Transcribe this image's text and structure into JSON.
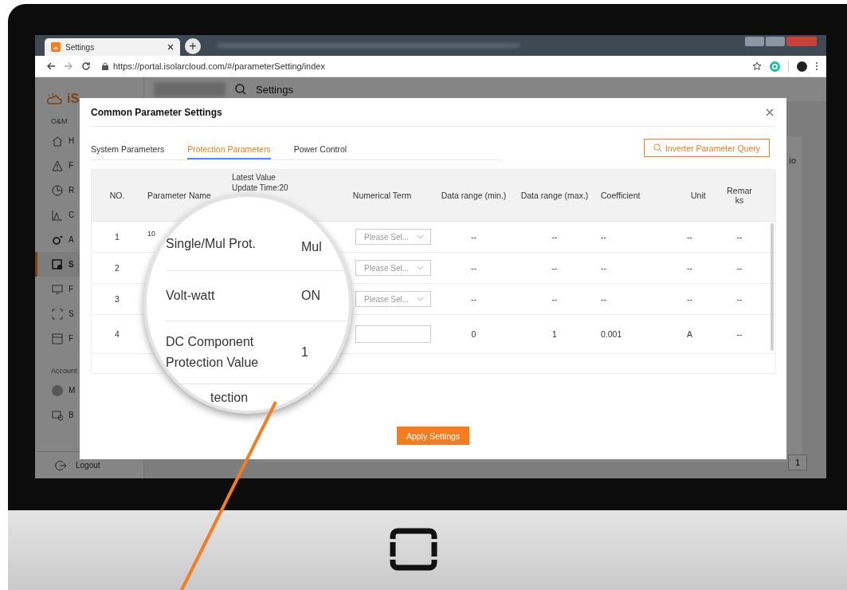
{
  "browser": {
    "tab_title": "Settings",
    "new_tab": "+",
    "url": "https://portal.isolarcloud.com/#/parameterSetting/index"
  },
  "app": {
    "logo": "iS",
    "header_title": "Settings",
    "section": "O&M",
    "sidebar": [
      {
        "label": "H",
        "kind": "home",
        "selected": false
      },
      {
        "label": "F",
        "kind": "alert",
        "selected": false
      },
      {
        "label": "R",
        "kind": "clock",
        "selected": false
      },
      {
        "label": "C",
        "kind": "chart",
        "selected": false
      },
      {
        "label": "A",
        "kind": "gear",
        "selected": false
      },
      {
        "label": "S",
        "kind": "settings",
        "selected": true
      },
      {
        "label": "F",
        "kind": "monitor",
        "selected": false
      },
      {
        "label": "S",
        "kind": "scan",
        "selected": false
      },
      {
        "label": "F",
        "kind": "form",
        "selected": false
      }
    ],
    "account_section": "Account",
    "account_items": [
      {
        "label": "M",
        "kind": "avatar"
      },
      {
        "label": "B",
        "kind": "device"
      }
    ],
    "logout": "Logout",
    "bg_column": "io",
    "bg_page": "1"
  },
  "modal": {
    "title": "Common Parameter Settings",
    "tabs": [
      {
        "label": "System Parameters",
        "selected": false
      },
      {
        "label": "Protection Parameters",
        "selected": true
      },
      {
        "label": "Power Control",
        "selected": false
      }
    ],
    "query_button": "Inverter Parameter Query",
    "columns": [
      "NO.",
      "Parameter Name",
      "Latest Value Update Time:20",
      "Numerical Term",
      "Data range (min.)",
      "Data range (max.)",
      "Coefficient",
      "Unit",
      "Remarks"
    ],
    "rows": [
      {
        "no": "1",
        "name": "10",
        "term": {
          "kind": "select",
          "placeholder": "Please Sel..."
        },
        "min": "--",
        "max": "--",
        "coefficient": "--",
        "unit": "--",
        "remarks": "--"
      },
      {
        "no": "2",
        "name": "",
        "term": {
          "kind": "select",
          "placeholder": "Please Sel..."
        },
        "min": "--",
        "max": "--",
        "coefficient": "--",
        "unit": "--",
        "remarks": "--"
      },
      {
        "no": "3",
        "name": "",
        "term": {
          "kind": "select",
          "placeholder": "Please Sel..."
        },
        "min": "--",
        "max": "--",
        "coefficient": "--",
        "unit": "--",
        "remarks": "--"
      },
      {
        "no": "4",
        "name": "",
        "term": {
          "kind": "input"
        },
        "min": "0",
        "max": "1",
        "coefficient": "0.001",
        "unit": "A",
        "remarks": "--"
      }
    ],
    "apply_button": "Apply Settings"
  },
  "magnifier": {
    "rows": [
      {
        "name": "Single/Mul Prot.",
        "value": "Mul"
      },
      {
        "name": "Volt-watt",
        "value": "ON"
      },
      {
        "name": "DC Component Protection Value",
        "value": "1"
      },
      {
        "name": "tection",
        "value": ""
      }
    ]
  }
}
